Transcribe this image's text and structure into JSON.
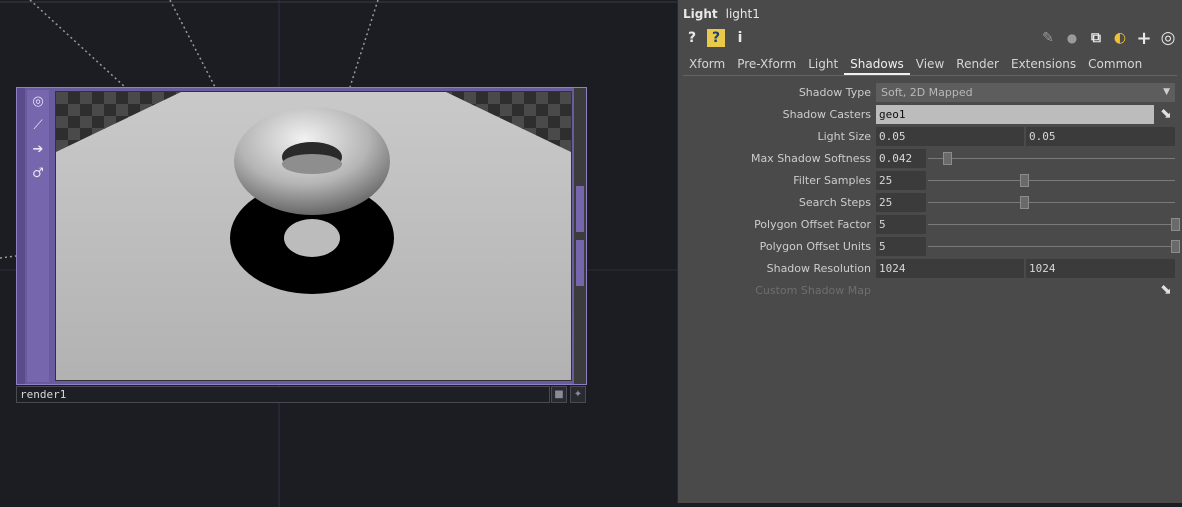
{
  "colors": {
    "node_accent": "#6a5a9e",
    "panel_bg": "#4a4a4a"
  },
  "node": {
    "name": "render1",
    "tools": [
      {
        "icon": "target-icon",
        "glyph": "◎"
      },
      {
        "icon": "chart-line-icon",
        "glyph": "⟋"
      },
      {
        "icon": "arrow-right-icon",
        "glyph": "➔"
      },
      {
        "icon": "link-icon",
        "glyph": "♂"
      }
    ],
    "flags": [
      {
        "icon": "display-flag-icon",
        "glyph": "■"
      },
      {
        "icon": "add-icon",
        "glyph": "✦"
      }
    ]
  },
  "panel": {
    "op_type": "Light",
    "op_name": "light1",
    "toolbar_left": [
      {
        "icon": "help-icon",
        "glyph": "?"
      },
      {
        "icon": "python-help-icon",
        "glyph": "?"
      },
      {
        "icon": "info-icon",
        "glyph": "i"
      }
    ],
    "toolbar_right": [
      {
        "icon": "pencil-icon",
        "glyph": "✎"
      },
      {
        "icon": "comment-icon",
        "glyph": "💬"
      },
      {
        "icon": "clone-icon",
        "glyph": "⧉"
      },
      {
        "icon": "python-icon",
        "glyph": "◐"
      },
      {
        "icon": "plus-icon",
        "glyph": "+"
      },
      {
        "icon": "target-icon",
        "glyph": "◎"
      }
    ],
    "tabs": [
      "Xform",
      "Pre-Xform",
      "Light",
      "Shadows",
      "View",
      "Render",
      "Extensions",
      "Common"
    ],
    "active_tab": "Shadows",
    "params": {
      "shadow_type": {
        "label": "Shadow Type",
        "value": "Soft, 2D Mapped"
      },
      "shadow_casters": {
        "label": "Shadow Casters",
        "value": "geo1"
      },
      "light_size": {
        "label": "Light Size",
        "v1": "0.05",
        "v2": "0.05"
      },
      "max_shadow_softness": {
        "label": "Max Shadow Softness",
        "value": "0.042",
        "slider": 0.06
      },
      "filter_samples": {
        "label": "Filter Samples",
        "value": "25",
        "slider": 0.38
      },
      "search_steps": {
        "label": "Search Steps",
        "value": "25",
        "slider": 0.38
      },
      "polygon_offset_factor": {
        "label": "Polygon Offset Factor",
        "value": "5",
        "slider": 1.0
      },
      "polygon_offset_units": {
        "label": "Polygon Offset Units",
        "value": "5",
        "slider": 1.0
      },
      "shadow_resolution": {
        "label": "Shadow Resolution",
        "v1": "1024",
        "v2": "1024"
      },
      "custom_shadow_map": {
        "label": "Custom Shadow Map"
      }
    }
  }
}
